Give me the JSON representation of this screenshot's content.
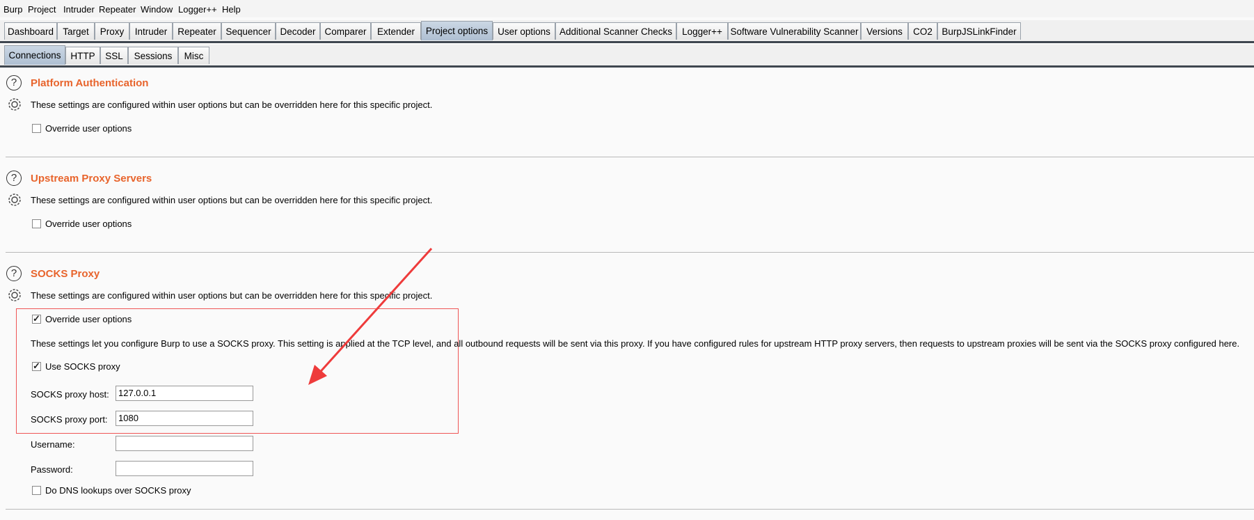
{
  "menu": [
    "Burp",
    "Project",
    "Intruder",
    "Repeater",
    "Window",
    "Logger++",
    "Help"
  ],
  "tabs": [
    "Dashboard",
    "Target",
    "Proxy",
    "Intruder",
    "Repeater",
    "Sequencer",
    "Decoder",
    "Comparer",
    "Extender",
    "Project options",
    "User options",
    "Additional Scanner Checks",
    "Logger++",
    "Software Vulnerability Scanner",
    "Versions",
    "CO2",
    "BurpJSLinkFinder"
  ],
  "active_tab": "Project options",
  "subtabs": [
    "Connections",
    "HTTP",
    "SSL",
    "Sessions",
    "Misc"
  ],
  "active_subtab": "Connections",
  "sections": {
    "platform_auth": {
      "title": "Platform Authentication",
      "desc": "These settings are configured within user options but can be overridden here for this specific project.",
      "override_label": "Override user options",
      "override_checked": false
    },
    "upstream_proxy": {
      "title": "Upstream Proxy Servers",
      "desc": "These settings are configured within user options but can be overridden here for this specific project.",
      "override_label": "Override user options",
      "override_checked": false
    },
    "socks_proxy": {
      "title": "SOCKS Proxy",
      "desc": "These settings are configured within user options but can be overridden here for this specific project.",
      "override_label": "Override user options",
      "override_checked": true,
      "info": "These settings let you configure Burp to use a SOCKS proxy. This setting is applied at the TCP level, and all outbound requests will be sent via this proxy. If you have configured rules for upstream HTTP proxy servers, then requests to upstream proxies will be sent via the SOCKS proxy configured here.",
      "use_socks_label": "Use SOCKS proxy",
      "use_socks_checked": true,
      "host_label": "SOCKS proxy host:",
      "host_value": "127.0.0.1",
      "port_label": "SOCKS proxy port:",
      "port_value": "1080",
      "username_label": "Username:",
      "username_value": "",
      "password_label": "Password:",
      "password_value": "",
      "dns_label": "Do DNS lookups over SOCKS proxy",
      "dns_checked": false
    }
  },
  "colors": {
    "section_title": "#e8642c",
    "highlight_box": "#ef5555",
    "arrow": "#ee3b3b",
    "active_tab": "#b9c9da"
  }
}
